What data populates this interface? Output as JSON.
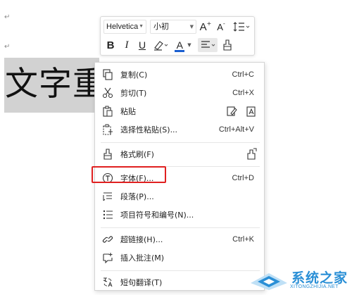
{
  "document": {
    "paragraph_mark": "↵",
    "selected_text": "文字重点"
  },
  "toolbar": {
    "font_name": "Helvetica",
    "font_size": "小初",
    "increase_font_label": "A",
    "decrease_font_label": "A",
    "bold_label": "B",
    "italic_label": "I",
    "underline_label": "U",
    "font_color_label": "A"
  },
  "menu": {
    "copy": {
      "label": "复制(C)",
      "shortcut": "Ctrl+C"
    },
    "cut": {
      "label": "剪切(T)",
      "shortcut": "Ctrl+X"
    },
    "paste": {
      "label": "粘贴"
    },
    "paste_special": {
      "label": "选择性粘贴(S)...",
      "shortcut": "Ctrl+Alt+V"
    },
    "format_painter": {
      "label": "格式刷(F)"
    },
    "font": {
      "label": "字体(F)...",
      "shortcut": "Ctrl+D"
    },
    "paragraph": {
      "label": "段落(P)..."
    },
    "bullets_numbering": {
      "label": "项目符号和编号(N)..."
    },
    "hyperlink": {
      "label": "超链接(H)...",
      "shortcut": "Ctrl+K"
    },
    "insert_comment": {
      "label": "插入批注(M)"
    },
    "translate": {
      "label": "短句翻译(T)"
    }
  },
  "watermark": {
    "title": "系统之家",
    "url": "XITONGZHIJIA.NET"
  },
  "colors": {
    "highlight": "#e02020",
    "watermark": "#2a8fd6",
    "selection": "#d2d2d2",
    "font_color_bar": "#1a5fd0"
  }
}
